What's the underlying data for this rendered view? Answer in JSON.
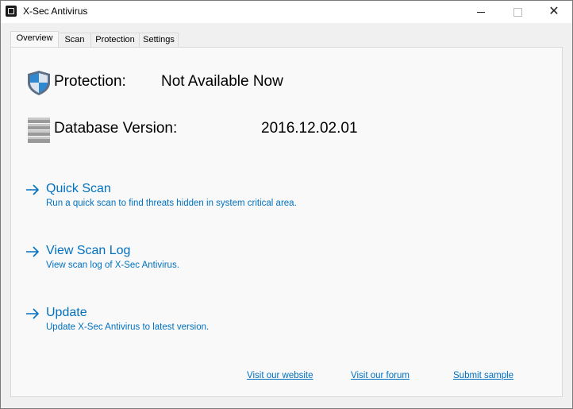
{
  "window": {
    "title": "X-Sec Antivirus"
  },
  "tabs": [
    "Overview",
    "Scan",
    "Protection",
    "Settings"
  ],
  "status": {
    "protection_label": "Protection:",
    "protection_value": "Not Available Now",
    "database_label": "Database Version:",
    "database_value": "2016.12.02.01"
  },
  "actions": [
    {
      "title": "Quick Scan",
      "description": "Run a quick scan to find threats hidden in system critical area."
    },
    {
      "title": "View Scan Log",
      "description": "View scan log of X-Sec Antivirus."
    },
    {
      "title": "Update",
      "description": "Update X-Sec Antivirus to latest version."
    }
  ],
  "footer": {
    "website": "Visit our website",
    "forum": "Visit our forum",
    "submit": "Submit sample"
  },
  "colors": {
    "link": "#0071c1",
    "background": "#f0f0f0"
  },
  "icons": [
    "app-icon",
    "shield-icon",
    "database-icon",
    "arrow-right-icon"
  ]
}
